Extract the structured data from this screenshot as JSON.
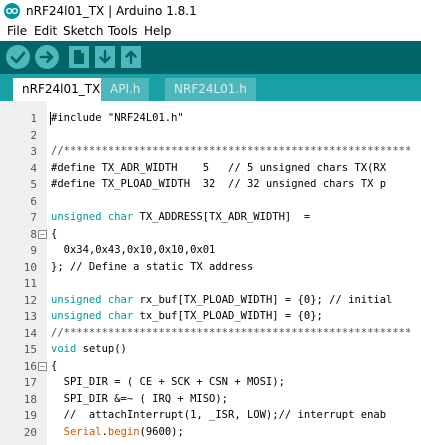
{
  "window": {
    "title": "nRF24l01_TX | Arduino 1.8.1"
  },
  "menu": {
    "items": [
      "File",
      "Edit",
      "Sketch",
      "Tools",
      "Help"
    ]
  },
  "toolbar": {
    "buttons": [
      "verify-icon",
      "upload-icon",
      "new-icon",
      "open-icon",
      "save-icon"
    ]
  },
  "tabs": [
    {
      "label": "nRF24l01_TX",
      "active": true
    },
    {
      "label": "API.h",
      "active": false
    },
    {
      "label": "NRF24L01.h",
      "active": false
    }
  ],
  "editor": {
    "lines": [
      {
        "n": "1",
        "fold": "",
        "segments": [
          {
            "t": "#include \"NRF24L01.h\"",
            "c": ""
          }
        ]
      },
      {
        "n": "2",
        "fold": "",
        "segments": []
      },
      {
        "n": "3",
        "fold": "",
        "segments": [
          {
            "t": "//*******************************************************",
            "c": "cm"
          }
        ]
      },
      {
        "n": "4",
        "fold": "",
        "segments": [
          {
            "t": "#define TX_ADR_WIDTH    5   // 5 unsigned chars TX(RX",
            "c": ""
          }
        ]
      },
      {
        "n": "5",
        "fold": "",
        "segments": [
          {
            "t": "#define TX_PLOAD_WIDTH  32  // 32 unsigned chars TX p",
            "c": ""
          }
        ]
      },
      {
        "n": "6",
        "fold": "",
        "segments": []
      },
      {
        "n": "7",
        "fold": "",
        "segments": [
          {
            "t": "unsigned char",
            "c": "kw"
          },
          {
            "t": " TX_ADDRESS[TX_ADR_WIDTH]  =",
            "c": ""
          }
        ]
      },
      {
        "n": "8",
        "fold": "⊟",
        "segments": [
          {
            "t": "{",
            "c": ""
          }
        ]
      },
      {
        "n": "9",
        "fold": "",
        "segments": [
          {
            "t": "  0x34,0x43,0x10,0x10,0x01",
            "c": ""
          }
        ]
      },
      {
        "n": "10",
        "fold": "",
        "segments": [
          {
            "t": "}; // Define a static TX address",
            "c": ""
          }
        ]
      },
      {
        "n": "11",
        "fold": "",
        "segments": []
      },
      {
        "n": "12",
        "fold": "",
        "segments": [
          {
            "t": "unsigned char",
            "c": "kw"
          },
          {
            "t": " rx_buf[TX_PLOAD_WIDTH] = {0}; // initial",
            "c": ""
          }
        ]
      },
      {
        "n": "13",
        "fold": "",
        "segments": [
          {
            "t": "unsigned char",
            "c": "kw"
          },
          {
            "t": " tx_buf[TX_PLOAD_WIDTH] = {0};",
            "c": ""
          }
        ]
      },
      {
        "n": "14",
        "fold": "",
        "segments": [
          {
            "t": "//*******************************************************",
            "c": "cm"
          }
        ]
      },
      {
        "n": "15",
        "fold": "",
        "segments": [
          {
            "t": "void",
            "c": "kw"
          },
          {
            "t": " setup()",
            "c": ""
          }
        ]
      },
      {
        "n": "16",
        "fold": "⊟",
        "segments": [
          {
            "t": "{",
            "c": ""
          }
        ]
      },
      {
        "n": "17",
        "fold": "",
        "segments": [
          {
            "t": "  SPI_DIR = ( CE + SCK + CSN + MOSI);",
            "c": ""
          }
        ]
      },
      {
        "n": "18",
        "fold": "",
        "segments": [
          {
            "t": "  SPI_DIR &=~ ( IRQ + MISO);",
            "c": ""
          }
        ]
      },
      {
        "n": "19",
        "fold": "",
        "segments": [
          {
            "t": "  //  attachInterrupt(1, _ISR, LOW);// interrupt enab",
            "c": ""
          }
        ]
      },
      {
        "n": "20",
        "fold": "",
        "segments": [
          {
            "t": "  ",
            "c": ""
          },
          {
            "t": "Serial",
            "c": "fn"
          },
          {
            "t": ".",
            "c": ""
          },
          {
            "t": "begin",
            "c": "fn"
          },
          {
            "t": "(9600);",
            "c": ""
          }
        ]
      }
    ]
  }
}
